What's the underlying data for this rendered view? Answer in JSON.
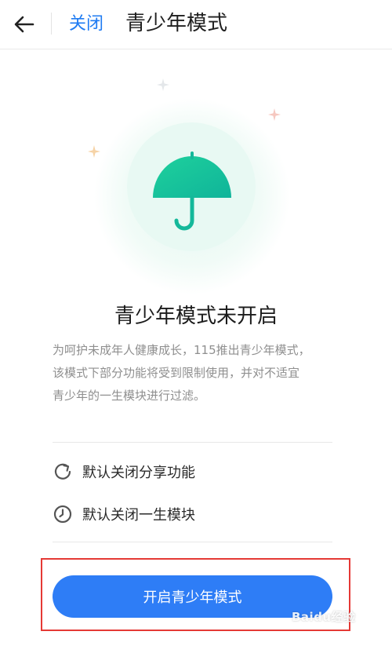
{
  "header": {
    "back_icon": "back-arrow-icon",
    "close_label": "关闭",
    "title": "青少年模式"
  },
  "hero": {
    "icon": "umbrella-icon",
    "accent_color": "#19c59d"
  },
  "status_title": "青少年模式未开启",
  "description_lines": [
    "为呵护未成年人健康成长，115推出青少年模式，",
    "该模式下部分功能将受到限制使用，并对不适宜",
    "青少年的一生模块进行过滤。"
  ],
  "features": [
    {
      "icon": "share-restricted-icon",
      "label": "默认关闭分享功能"
    },
    {
      "icon": "clock-icon",
      "label": "默认关闭一生模块"
    }
  ],
  "primary_button": {
    "label": "开启青少年模式",
    "color": "#2e7df6"
  },
  "highlight_color": "#e53935",
  "watermark": "Baidu经验"
}
